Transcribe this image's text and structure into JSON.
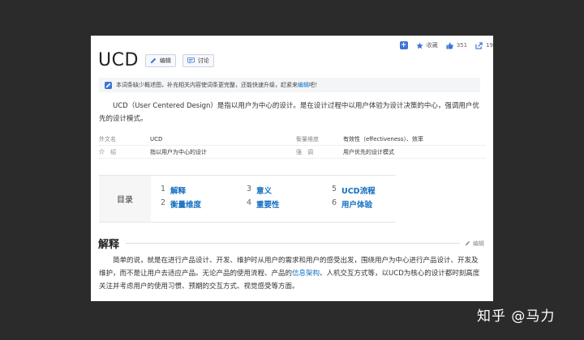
{
  "toolbar": {
    "favorite_label": "收藏",
    "like_count": "351",
    "share_count": "19"
  },
  "title": "UCD",
  "buttons": {
    "edit": "编辑",
    "discuss": "讨论"
  },
  "notice": {
    "text": "本词条缺少概述图，补充相关内容使词条更完整，还能快速升级，赶紧来",
    "link": "编辑",
    "suffix": "吧！"
  },
  "intro": "UCD（User Centered Design）是指以用户为中心的设计。是在设计过程中以用户体验为设计决策的中心，强调用户优先的设计模式。",
  "basic_info": {
    "row1": {
      "k1": "外文名",
      "v1": "UCD",
      "k2": "衡量维度",
      "v2": "有效性（effectiveness）、效率"
    },
    "row2": {
      "k1": "介　绍",
      "v1": "指以用户为中心的设计",
      "k2": "强　调",
      "v2": "用户优先的设计模式"
    }
  },
  "toc": {
    "title": "目录",
    "items": [
      {
        "num": "1",
        "label": "解释"
      },
      {
        "num": "2",
        "label": "衡量维度"
      },
      {
        "num": "3",
        "label": "意义"
      },
      {
        "num": "4",
        "label": "重要性"
      },
      {
        "num": "5",
        "label": "UCD流程"
      },
      {
        "num": "6",
        "label": "用户体验"
      }
    ]
  },
  "section": {
    "title": "解释",
    "edit_label": "编辑",
    "para_part1": "简单的说，就是在进行产品设计、开发、维护时从用户的需求和用户的感受出发，围绕用户为中心进行产品设计、开发及维护，而不是让用户去适应产品。无论产品的使用流程、产品的",
    "para_link": "信息架构",
    "para_part2": "、人机交互方式等，以UCD为核心的设计都时刻高度关注并考虑用户的使用习惯、预期的交互方式、视觉感受等方面。"
  },
  "watermark": "知乎 @马力",
  "colors": {
    "link": "#136ec2",
    "accent": "#3d74d6",
    "background": "#2b2b2b"
  }
}
